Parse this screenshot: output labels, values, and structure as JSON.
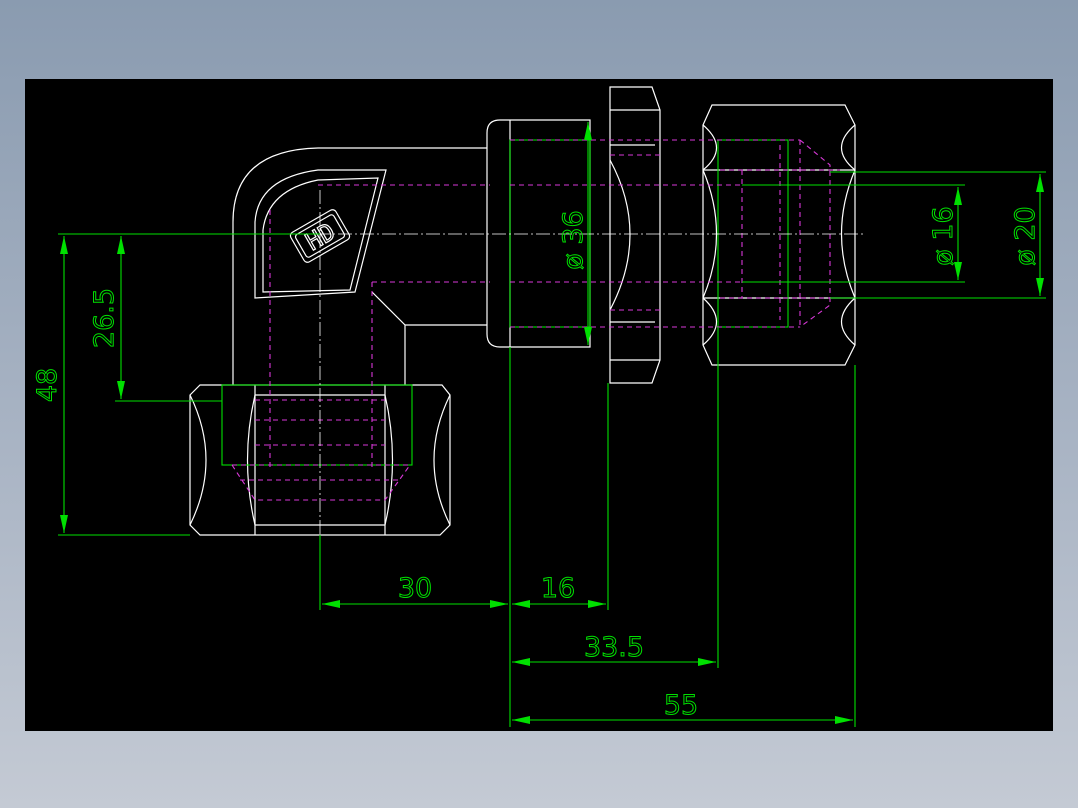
{
  "drawing": {
    "background": "#000000",
    "colors": {
      "outline": "#ffffff",
      "hidden": "#d838d8",
      "dimension": "#00e000"
    },
    "logo_text": "HD",
    "dimensions": {
      "d48": "48",
      "d26_5": "26.5",
      "d36": "ø 36",
      "d16": "ø 16",
      "d20": "ø 20",
      "d30": "30",
      "d16h": "16",
      "d33_5": "33.5",
      "d55": "55"
    }
  }
}
